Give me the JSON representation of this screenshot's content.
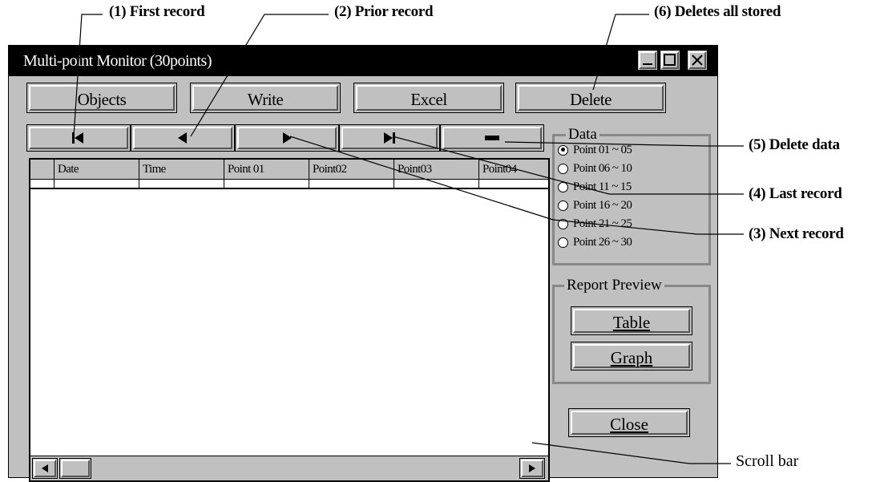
{
  "callouts": {
    "first": "(1) First record",
    "prior": "(2) Prior record",
    "deletes_all": "(6) Deletes all stored",
    "delete_data": "(5) Delete data",
    "last": "(4) Last record",
    "next": "(3) Next record",
    "scroll": "Scroll bar"
  },
  "window": {
    "title": "Multi-point Monitor (30points)"
  },
  "toolbar": {
    "objects": "Objects",
    "write": "Write",
    "excel": "Excel",
    "delete": "Delete"
  },
  "grid": {
    "columns": [
      "Date",
      "Time",
      "Point 01",
      "Point02",
      "Point03",
      "Point04"
    ]
  },
  "data_group": {
    "label": "Data",
    "options": [
      "Point 01 ~ 05",
      "Point 06 ~ 10",
      "Point 11 ~ 15",
      "Point 16 ~ 20",
      "Point 21 ~ 25",
      "Point 26 ~ 30"
    ],
    "selected_index": 0
  },
  "report_preview": {
    "label": "Report Preview",
    "table": "Table",
    "graph": "Graph"
  },
  "close": "Close",
  "icons": {
    "first": "first-record-icon",
    "prior": "prior-record-icon",
    "next": "next-record-icon",
    "last": "last-record-icon",
    "delete": "delete-record-icon"
  }
}
